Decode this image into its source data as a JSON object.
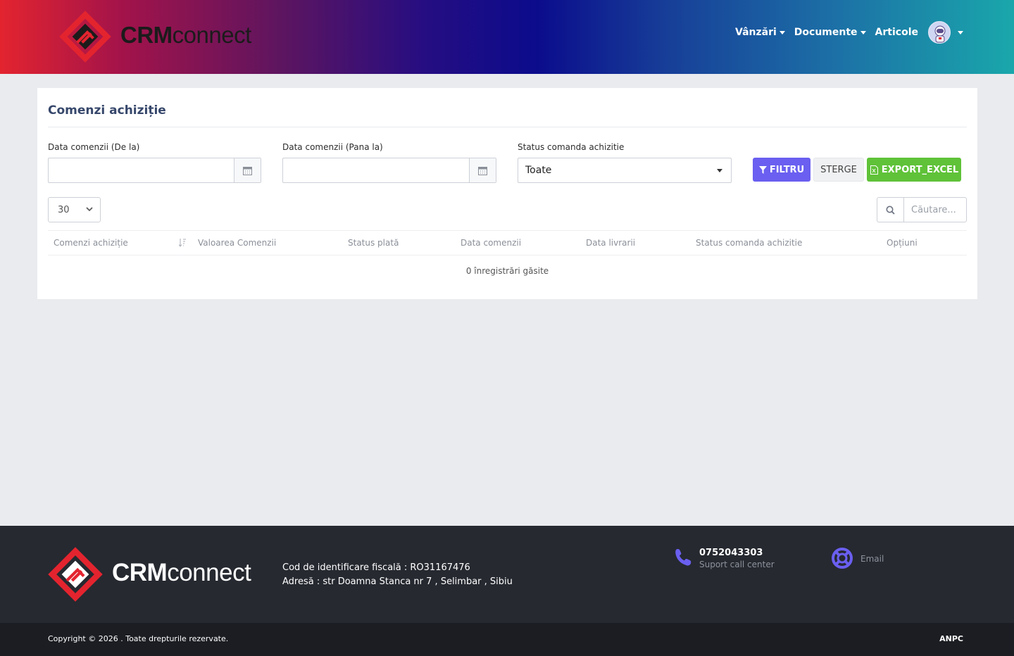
{
  "brand": {
    "name_bold": "CRM",
    "name_regular": "connect"
  },
  "nav": {
    "items": [
      {
        "label": "Vânzări",
        "has_dropdown": true
      },
      {
        "label": "Documente",
        "has_dropdown": true
      },
      {
        "label": "Articole",
        "has_dropdown": false
      }
    ],
    "avatar_icon": "astronaut-avatar"
  },
  "page": {
    "title": "Comenzi achiziție",
    "filters": {
      "date_from": {
        "label": "Data comenzii (De la)",
        "value": ""
      },
      "date_to": {
        "label": "Data comenzii (Pana la)",
        "value": ""
      },
      "status": {
        "label": "Status comanda achizitie",
        "selected": "Toate"
      }
    },
    "buttons": {
      "filter": "FILTRU",
      "clear": "STERGE",
      "export": "EXPORT_EXCEL"
    },
    "page_size": "30",
    "search_placeholder": "Căutare...",
    "table": {
      "columns": [
        "Comenzi achiziție",
        "Valoarea Comenzii",
        "Status plată",
        "Data comenzii",
        "Data livrarii",
        "Status comanda achizitie",
        "Opțiuni"
      ],
      "empty_message": "0 înregistrări găsite"
    }
  },
  "footer": {
    "fiscal_code": "Cod de identificare fiscală : RO31167476",
    "address": "Adresă : str Doamna Stanca nr 7 , Selimbar , Sibiu",
    "phone": "0752043303",
    "phone_caption": "Suport call center",
    "email_label": "Email",
    "copyright": "Copyright © 2026 . Toate drepturile rezervate.",
    "anpc": "ANPC"
  },
  "colors": {
    "accent_purple": "#6a5ff0",
    "export_green": "#5fc238",
    "logo_red": "#e3242f",
    "footer_bg": "#262930"
  }
}
